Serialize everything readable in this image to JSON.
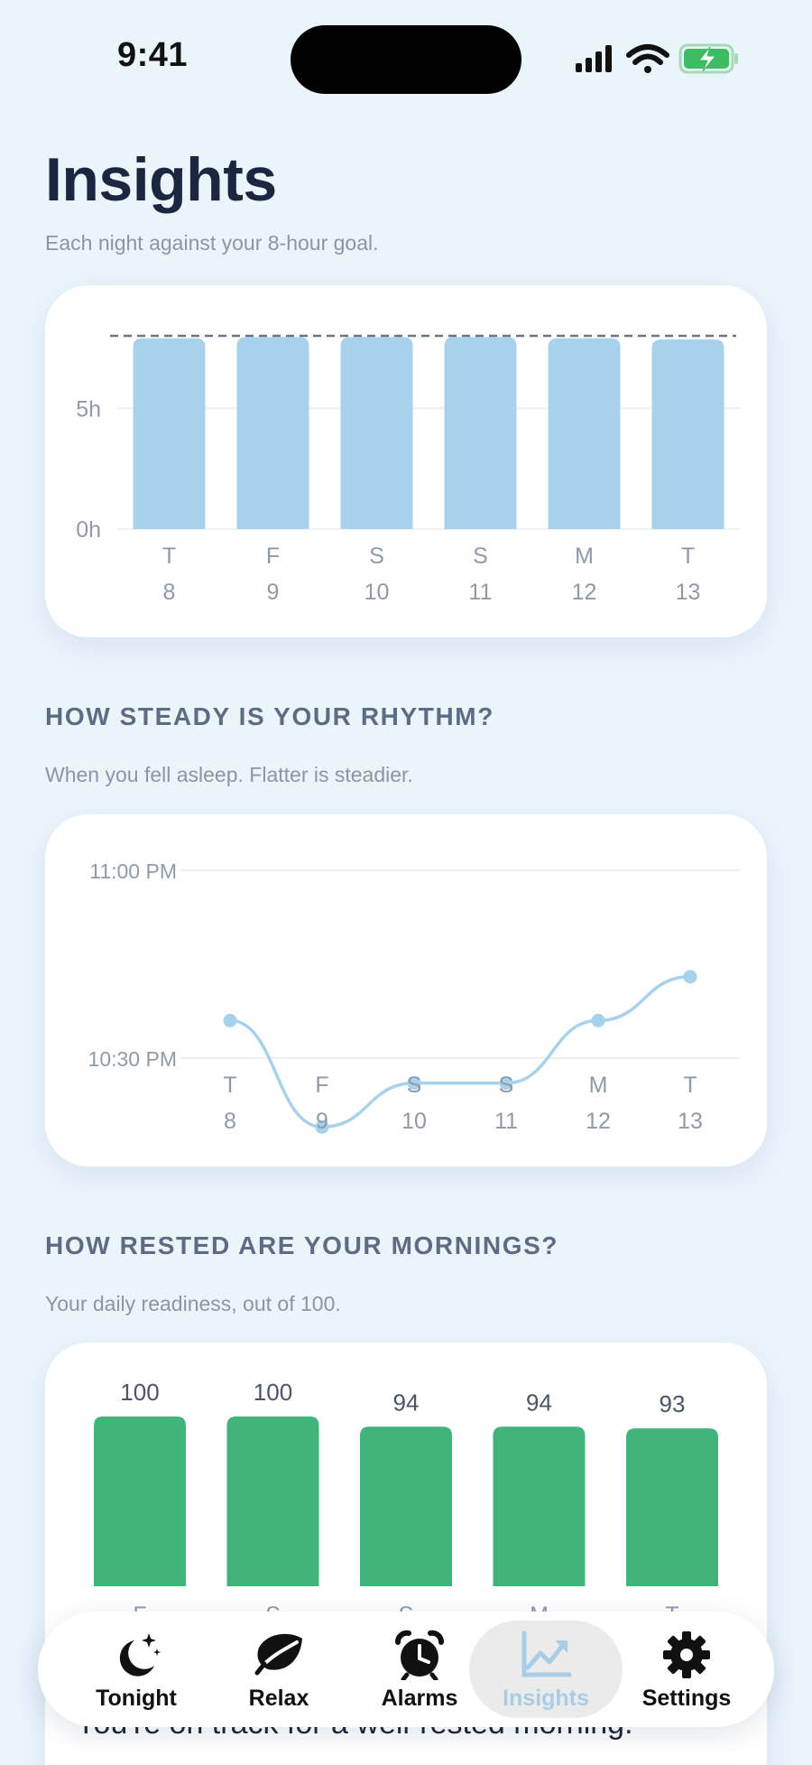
{
  "status_bar": {
    "time": "9:41"
  },
  "page": {
    "title": "Insights"
  },
  "sleep_section": {
    "subtitle": "Each night against your 8-hour goal.",
    "chart_data": {
      "type": "bar",
      "categories": [
        "T 8",
        "F 9",
        "S 10",
        "S 11",
        "M 12",
        "T 13"
      ],
      "day_letters": [
        "T",
        "F",
        "S",
        "S",
        "M",
        "T"
      ],
      "day_numbers": [
        "8",
        "9",
        "10",
        "11",
        "12",
        "13"
      ],
      "values": [
        7.9,
        7.95,
        7.95,
        7.95,
        7.9,
        7.85
      ],
      "goal": 8,
      "yticks": [
        0,
        5
      ],
      "ytick_labels": [
        "0h",
        "5h"
      ],
      "ylim": [
        0,
        8.6
      ],
      "color": "#a8d1eb"
    }
  },
  "rhythm_section": {
    "title": "HOW STEADY IS YOUR RHYTHM?",
    "subtitle": "When you fell asleep. Flatter is steadier.",
    "chart_data": {
      "type": "line",
      "categories": [
        "T 8",
        "F 9",
        "S 10",
        "S 11",
        "M 12",
        "T 13"
      ],
      "day_letters": [
        "T",
        "F",
        "S",
        "S",
        "M",
        "T"
      ],
      "day_numbers": [
        "8",
        "9",
        "10",
        "11",
        "12",
        "13"
      ],
      "y_minutes": [
        22.6,
        22.32,
        22.44,
        22.44,
        22.6,
        22.72
      ],
      "y_labels_values": [
        "22:36",
        "22:19",
        "22:26",
        "22:26",
        "22:36",
        "22:43"
      ],
      "yticks_minutes_after_10pm": [
        30,
        60
      ],
      "ytick_labels": [
        "10:30 PM",
        "11:00 PM"
      ],
      "color": "#a8d1eb"
    }
  },
  "mornings_section": {
    "title": "HOW RESTED ARE YOUR MORNINGS?",
    "subtitle": "Your daily readiness, out of 100.",
    "chart_data": {
      "type": "bar",
      "categories": [
        "F",
        "S",
        "S",
        "M",
        "T"
      ],
      "day_letters": [
        "F",
        "S",
        "S",
        "M",
        "T"
      ],
      "values": [
        100,
        100,
        94,
        94,
        93
      ],
      "value_labels": [
        "100",
        "100",
        "94",
        "94",
        "93"
      ],
      "ylim": [
        0,
        100
      ],
      "color": "#43b37c"
    }
  },
  "tab_bar": {
    "tabs": [
      {
        "label": "Tonight",
        "icon": "moon-stars-icon"
      },
      {
        "label": "Relax",
        "icon": "leaf-icon"
      },
      {
        "label": "Alarms",
        "icon": "alarm-clock-icon"
      },
      {
        "label": "Insights",
        "icon": "chart-trend-icon",
        "active": true
      },
      {
        "label": "Settings",
        "icon": "gear-icon"
      }
    ]
  },
  "behind_message": "You're on track for a well-rested morning."
}
